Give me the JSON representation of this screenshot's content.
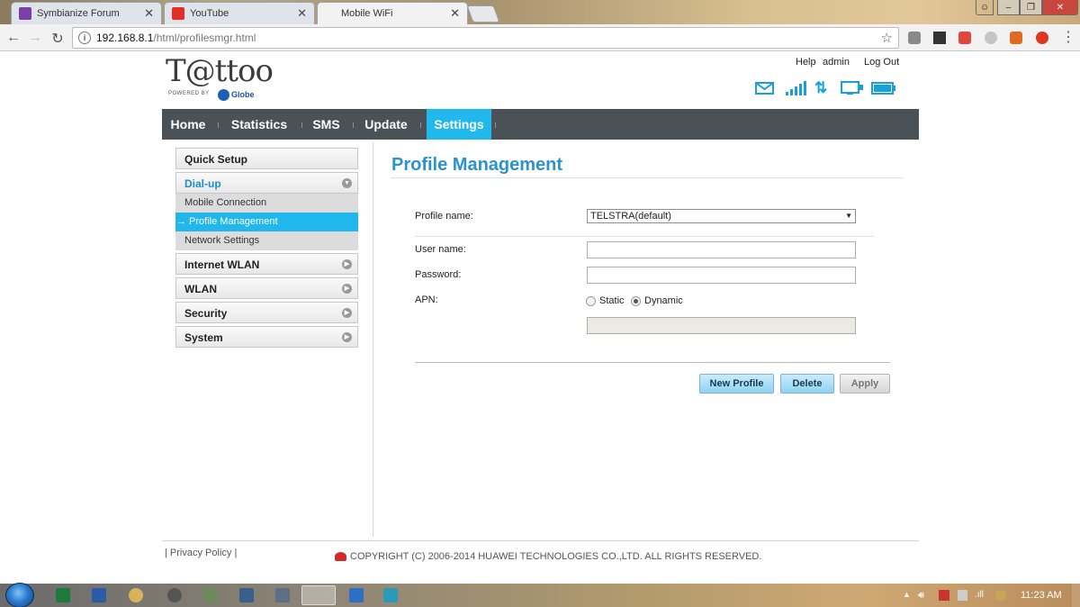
{
  "browser": {
    "tabs": [
      {
        "title": "Symbianize Forum"
      },
      {
        "title": "YouTube"
      },
      {
        "title": "Mobile WiFi"
      }
    ],
    "url_host": "192.168.8.1",
    "url_path": "/html/profilesmgr.html"
  },
  "header": {
    "brand": "T@ttoo",
    "powered_by": "POWERED BY",
    "partner": "Globe",
    "links": {
      "help": "Help",
      "user": "admin",
      "logout": "Log Out"
    }
  },
  "nav": {
    "items": [
      "Home",
      "Statistics",
      "SMS",
      "Update",
      "Settings"
    ],
    "active": "Settings"
  },
  "sidebar": {
    "quick_setup": "Quick Setup",
    "dialup": "Dial-up",
    "dialup_items": [
      "Mobile Connection",
      "→ Profile Management",
      "Network Settings"
    ],
    "internet_wlan": "Internet WLAN",
    "wlan": "WLAN",
    "security": "Security",
    "system": "System"
  },
  "main": {
    "title": "Profile Management",
    "profile_name_label": "Profile name:",
    "profile_name_value": "TELSTRA(default)",
    "username_label": "User name:",
    "password_label": "Password:",
    "apn_label": "APN:",
    "apn_static": "Static",
    "apn_dynamic": "Dynamic",
    "apn_selected": "Dynamic",
    "buttons": {
      "new_profile": "New Profile",
      "delete": "Delete",
      "apply": "Apply"
    }
  },
  "footer": {
    "privacy": "Privacy Policy",
    "copyright": "COPYRIGHT (C) 2006-2014 HUAWEI TECHNOLOGIES CO.,LTD. ALL RIGHTS RESERVED."
  },
  "taskbar": {
    "clock": "11:23 AM"
  },
  "colors": {
    "accent": "#21b8ed",
    "title_blue": "#2a93cf",
    "nav_bg": "#4b5257"
  }
}
